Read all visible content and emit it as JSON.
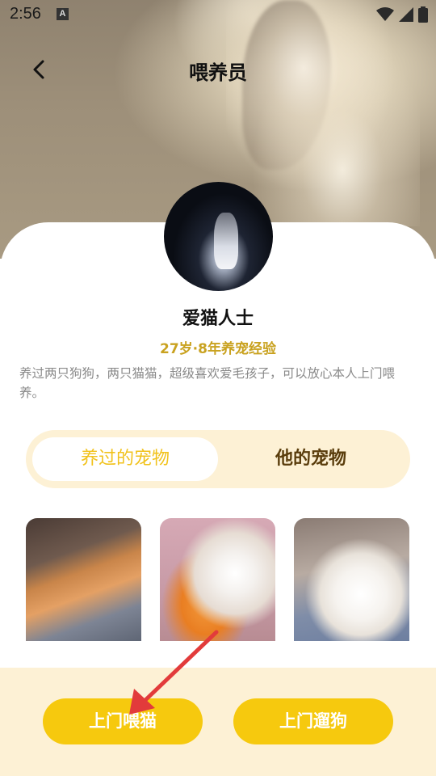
{
  "status_bar": {
    "time": "2:56",
    "notification_icon_letter": "A",
    "icons": [
      "wifi-icon",
      "signal-icon",
      "battery-icon"
    ]
  },
  "header": {
    "title": "喂养员",
    "back_icon": "chevron-left-icon"
  },
  "profile": {
    "name": "爱猫人士",
    "meta": "27岁·8年养宠经验",
    "description": "养过两只狗狗，两只猫猫，超级喜欢爱毛孩子，可以放心本人上门喂养。"
  },
  "tabs": [
    {
      "label": "养过的宠物",
      "active": true
    },
    {
      "label": "他的宠物",
      "active": false
    }
  ],
  "pets": [
    {
      "icon": "orange-cat-photo"
    },
    {
      "icon": "white-cat-photo"
    },
    {
      "icon": "white-puppy-photo"
    }
  ],
  "actions": {
    "feed_cat_label": "上门喂猫",
    "walk_dog_label": "上门遛狗"
  },
  "colors": {
    "accent": "#f6c90e",
    "tab_active_text": "#f1c21b",
    "tab_inactive_text": "#5a3d0c",
    "meta_text": "#c9a220",
    "cream": "#fdf1d5",
    "arrow": "#e23b3b"
  }
}
